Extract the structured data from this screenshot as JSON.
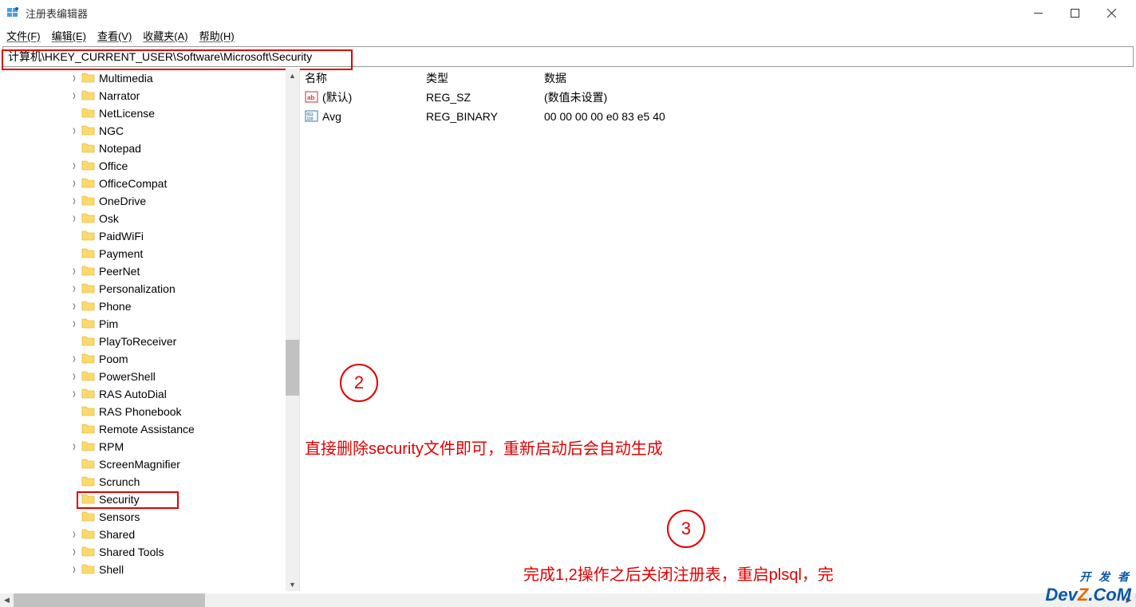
{
  "window": {
    "title": "注册表编辑器"
  },
  "menu": {
    "file": "文件(F)",
    "edit": "编辑(E)",
    "view": "查看(V)",
    "favorites": "收藏夹(A)",
    "help": "帮助(H)"
  },
  "address": {
    "path": "计算机\\HKEY_CURRENT_USER\\Software\\Microsoft\\Security"
  },
  "tree": {
    "items": [
      {
        "label": "Multimedia",
        "expandable": true
      },
      {
        "label": "Narrator",
        "expandable": true
      },
      {
        "label": "NetLicense",
        "expandable": false
      },
      {
        "label": "NGC",
        "expandable": true
      },
      {
        "label": "Notepad",
        "expandable": false
      },
      {
        "label": "Office",
        "expandable": true
      },
      {
        "label": "OfficeCompat",
        "expandable": true
      },
      {
        "label": "OneDrive",
        "expandable": true
      },
      {
        "label": "Osk",
        "expandable": true
      },
      {
        "label": "PaidWiFi",
        "expandable": false
      },
      {
        "label": "Payment",
        "expandable": false
      },
      {
        "label": "PeerNet",
        "expandable": true
      },
      {
        "label": "Personalization",
        "expandable": true
      },
      {
        "label": "Phone",
        "expandable": true
      },
      {
        "label": "Pim",
        "expandable": true
      },
      {
        "label": "PlayToReceiver",
        "expandable": false
      },
      {
        "label": "Poom",
        "expandable": true
      },
      {
        "label": "PowerShell",
        "expandable": true
      },
      {
        "label": "RAS AutoDial",
        "expandable": true
      },
      {
        "label": "RAS Phonebook",
        "expandable": false
      },
      {
        "label": "Remote Assistance",
        "expandable": false
      },
      {
        "label": "RPM",
        "expandable": true
      },
      {
        "label": "ScreenMagnifier",
        "expandable": false
      },
      {
        "label": "Scrunch",
        "expandable": false
      },
      {
        "label": "Security",
        "expandable": false,
        "selected": true
      },
      {
        "label": "Sensors",
        "expandable": false
      },
      {
        "label": "Shared",
        "expandable": true
      },
      {
        "label": "Shared Tools",
        "expandable": true
      },
      {
        "label": "Shell",
        "expandable": true
      }
    ]
  },
  "columns": {
    "name": "名称",
    "type": "类型",
    "data": "数据"
  },
  "values": [
    {
      "icon": "string",
      "name": "(默认)",
      "type": "REG_SZ",
      "data": "(数值未设置)"
    },
    {
      "icon": "binary",
      "name": "Avg",
      "type": "REG_BINARY",
      "data": "00 00 00 00 e0 83 e5 40"
    }
  ],
  "annotations": {
    "step2_num": "2",
    "step2_text": "直接删除security文件即可，重新启动后会自动生成",
    "step3_num": "3",
    "step3_text": "完成1,2操作之后关闭注册表，重启plsql，完"
  },
  "watermark": {
    "line1": "开 发 者",
    "line2a": "Dev",
    "line2b": "Z",
    "line2c": ".CoM"
  }
}
